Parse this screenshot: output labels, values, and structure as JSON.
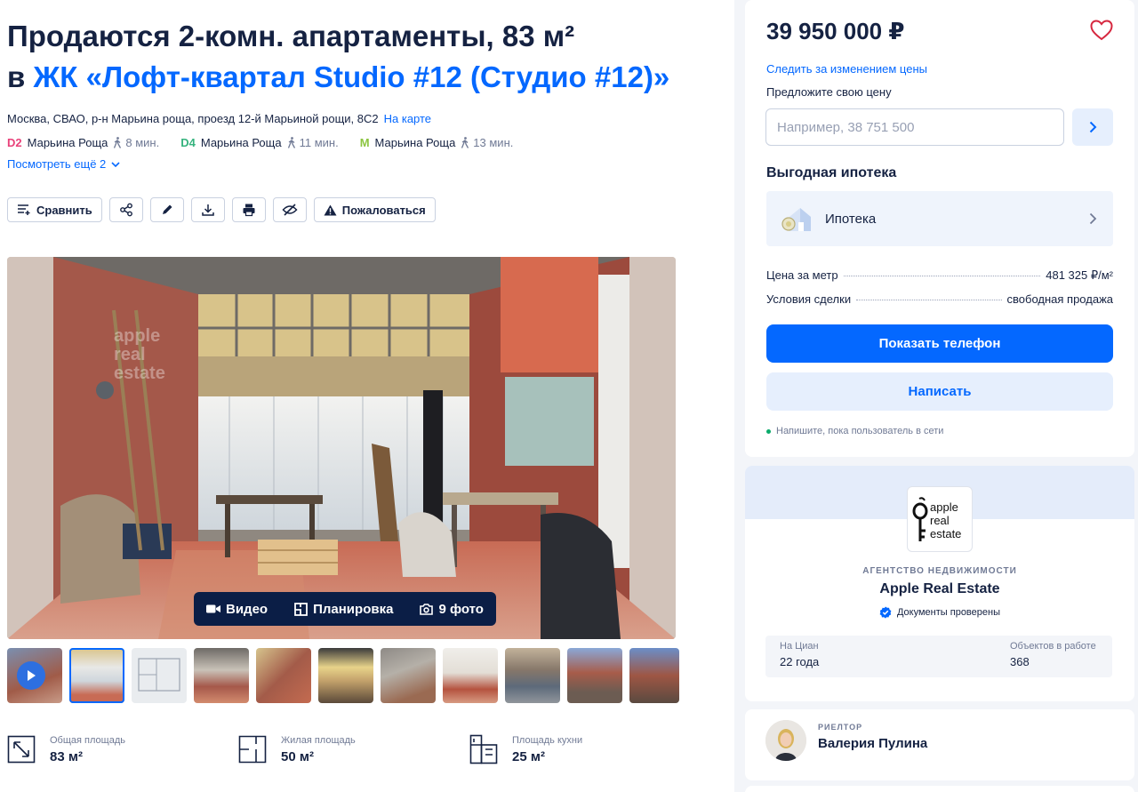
{
  "title": {
    "line1": "Продаются 2-комн. апартаменты, 83 м²",
    "line2_prefix": "в ",
    "complex_link": "ЖК «Лофт-квартал Studio #12 (Студио #12)»"
  },
  "address": {
    "text": "Москва, СВАО, р-н Марьина роща, проезд 12-й Марьиной рощи, 8С2",
    "map_link": "На карте"
  },
  "metro": [
    {
      "code": "D2",
      "color": "#e9417a",
      "station": "Марьина Роща",
      "walk": "8 мин."
    },
    {
      "code": "D4",
      "color": "#36b37e",
      "station": "Марьина Роща",
      "walk": "11 мин."
    },
    {
      "code": "M",
      "color": "#8cc540",
      "station": "Марьина Роща",
      "walk": "13 мин."
    }
  ],
  "more_link": "Посмотреть ещё 2",
  "actions": {
    "compare": "Сравнить",
    "report": "Пожаловаться",
    "icons": [
      "share-icon",
      "edit-icon",
      "download-icon",
      "print-icon",
      "hide-icon"
    ]
  },
  "gallery": {
    "tabs": {
      "video": "Видео",
      "layout": "Планировка",
      "photos": "9 фото"
    },
    "watermark": "apple real estate"
  },
  "features": [
    {
      "label": "Общая площадь",
      "value": "83 м²",
      "icon": "area-icon"
    },
    {
      "label": "Жилая площадь",
      "value": "50 м²",
      "icon": "living-area-icon"
    },
    {
      "label": "Площадь кухни",
      "value": "25 м²",
      "icon": "kitchen-icon"
    }
  ],
  "sidebar": {
    "price": "39 950 000 ₽",
    "follow_price": "Следить за изменением цены",
    "offer_label": "Предложите свою цену",
    "offer_placeholder": "Например, 38 751 500",
    "mortgage_title": "Выгодная ипотека",
    "mortgage_item": "Ипотека",
    "price_per_meter_label": "Цена за метр",
    "price_per_meter_value": "481 325 ₽/м²",
    "deal_label": "Условия сделки",
    "deal_value": "свободная продажа",
    "show_phone": "Показать телефон",
    "write": "Написать",
    "online_hint": "Напишите, пока пользователь в сети"
  },
  "agency": {
    "logo_text": [
      "apple",
      "real",
      "estate"
    ],
    "type": "АГЕНТСТВО НЕДВИЖИМОСТИ",
    "name": "Apple Real Estate",
    "verified": "Документы проверены",
    "on_cian_label": "На Циан",
    "on_cian_value": "22 года",
    "objects_label": "Объектов в работе",
    "objects_value": "368"
  },
  "realtor": {
    "type": "РИЕЛТОР",
    "name": "Валерия Пулина"
  },
  "colors": {
    "accent": "#0468ff",
    "text": "#152242",
    "muted": "#707a95",
    "online": "#0bab6b",
    "heart": "#d6273f"
  }
}
